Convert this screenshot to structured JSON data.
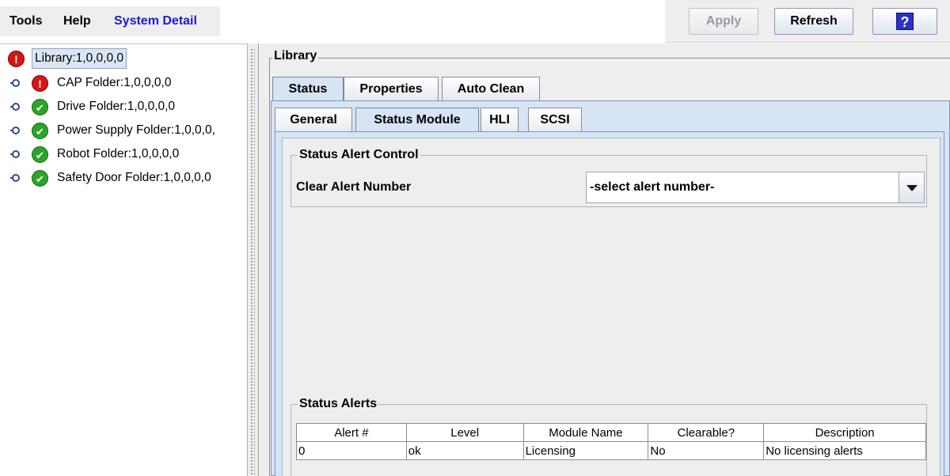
{
  "menubar": {
    "tools": "Tools",
    "help": "Help",
    "system_detail": "System Detail"
  },
  "toolbar": {
    "apply": "Apply",
    "refresh": "Refresh",
    "help_glyph": "?"
  },
  "tree": {
    "root": {
      "label": "Library:1,0,0,0,0",
      "status": "error"
    },
    "items": [
      {
        "label": "CAP Folder:1,0,0,0,0",
        "status": "error"
      },
      {
        "label": "Drive Folder:1,0,0,0,0",
        "status": "ok"
      },
      {
        "label": "Power Supply Folder:1,0,0,0,",
        "status": "ok"
      },
      {
        "label": "Robot Folder:1,0,0,0,0",
        "status": "ok"
      },
      {
        "label": "Safety Door Folder:1,0,0,0,0",
        "status": "ok"
      }
    ]
  },
  "panel": {
    "title": "Library",
    "tabs": [
      "Status",
      "Properties",
      "Auto Clean"
    ],
    "selected_tab": "Status",
    "subtabs": [
      "General",
      "Status Module",
      "HLI",
      "SCSI"
    ],
    "selected_subtab": "Status Module"
  },
  "alert_control": {
    "title": "Status Alert Control",
    "label": "Clear Alert Number",
    "select_value": "-select alert number-"
  },
  "status_alerts": {
    "title": "Status Alerts",
    "columns": [
      "Alert #",
      "Level",
      "Module Name",
      "Clearable?",
      "Description"
    ],
    "rows": [
      [
        "0",
        "ok",
        "Licensing",
        "No",
        "No licensing alerts"
      ]
    ]
  },
  "colors": {
    "link_blue": "#1a1adb",
    "selected_tab": "#d7e4f4",
    "error_red": "#d61616",
    "ok_green": "#2aa52a"
  },
  "icons": {
    "error": "exclamation-icon",
    "ok": "checkmark-icon",
    "expand": "tree-expand-handle",
    "dropdown": "chevron-down-icon",
    "help": "question-icon"
  }
}
